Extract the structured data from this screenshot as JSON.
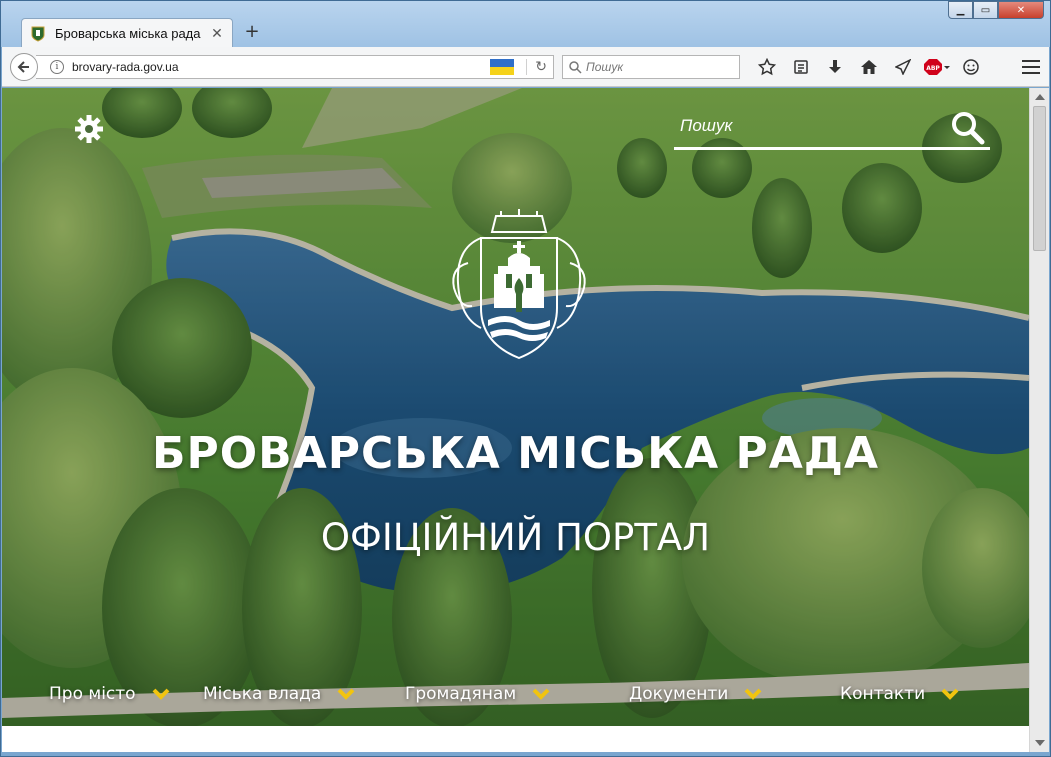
{
  "browser": {
    "tab_title": "Броварська міська рада",
    "url": "brovary-rada.gov.ua",
    "search_placeholder": "Пошук"
  },
  "site": {
    "search_placeholder": "Пошук",
    "title": "БРОВАРСЬКА МІСЬКА РАДА",
    "subtitle": "ОФІЦІЙНИЙ ПОРТАЛ",
    "nav": [
      {
        "label": "Про місто"
      },
      {
        "label": "Міська влада"
      },
      {
        "label": "Громадянам"
      },
      {
        "label": "Документи"
      },
      {
        "label": "Контакти"
      }
    ]
  },
  "toolbar_icons": [
    "bookmark-star-icon",
    "reading-list-icon",
    "download-icon",
    "home-icon",
    "send-icon",
    "adblock-icon",
    "emoji-icon"
  ],
  "colors": {
    "accent_chevron": "#f1c40f",
    "flag_blue": "#2f6fc9",
    "flag_yellow": "#f5d21a"
  }
}
